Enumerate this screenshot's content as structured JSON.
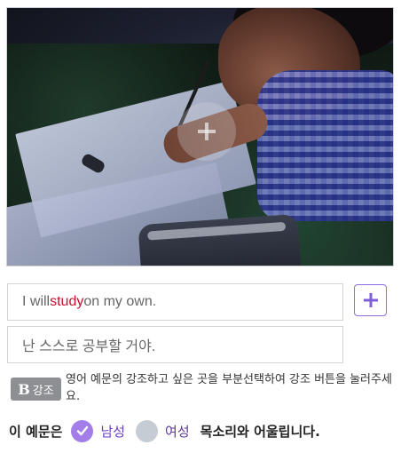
{
  "photo": {
    "icon": "play-circle-icon"
  },
  "sentence": {
    "en_before": "I will ",
    "en_highlight": "study",
    "en_after": " on my own.",
    "ko": "난 스스로 공부할 거야."
  },
  "add_button": {
    "icon": "plus-icon"
  },
  "emphasis": {
    "badge_letter": "B",
    "badge_label": "강조",
    "hint": "영어 예문의 강조하고 싶은 곳을 부분선택하여 강조 버튼을 눌러주세요."
  },
  "voice": {
    "lead": "이 예문은",
    "option_male": "남성",
    "option_female": "여성",
    "tail": "목소리와 어울립니다.",
    "selected": "남성"
  },
  "colors": {
    "accent": "#a37de8",
    "highlight": "#c8102e",
    "badge": "#8d8f93"
  }
}
